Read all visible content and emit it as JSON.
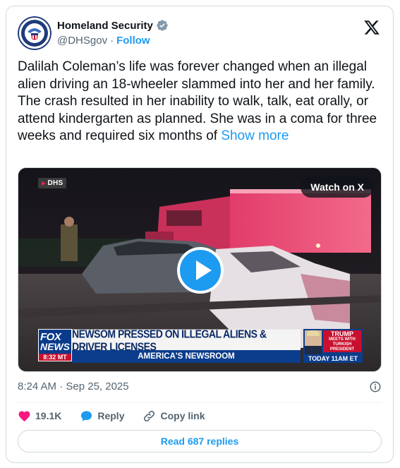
{
  "account": {
    "name": "Homeland Security",
    "handle": "@DHSgov",
    "separator": "·",
    "follow_label": "Follow",
    "avatar_icon": "dhs-seal-icon",
    "verified_icon": "verified-badge-icon"
  },
  "tweet": {
    "text": "Dalilah Coleman’s life was forever changed when an illegal alien driving an 18-wheeler slammed into her and her family. The crash resulted in her inability to walk, talk, eat orally, or attend kindergarten as planned. She was in a coma for three weeks and required six months of ",
    "show_more": "Show more"
  },
  "media": {
    "source_tag": "DHS",
    "watch_label": "Watch on X",
    "chyron": {
      "network_line1": "FOX",
      "network_line2": "NEWS",
      "network_time": "8:32 MT",
      "headline": "NEWSOM PRESSED ON ILLEGAL ALIENS & DRIVER LICENSES",
      "program": "AMERICA'S NEWSROOM",
      "promo_line1": "TRUMP",
      "promo_line2": "MEETS WITH",
      "promo_line3": "TURKISH",
      "promo_line4": "PRESIDENT",
      "promo_time": "TODAY 11AM ET"
    }
  },
  "meta": {
    "timestamp": "8:24 AM · Sep 25, 2025"
  },
  "actions": {
    "like_count": "19.1K",
    "reply_label": "Reply",
    "copy_label": "Copy link"
  },
  "read_replies": "Read 687 replies",
  "colors": {
    "accent": "#1d9bf0",
    "like": "#f91880",
    "text": "#0f1419",
    "muted": "#536471",
    "border": "#cfd9de"
  }
}
